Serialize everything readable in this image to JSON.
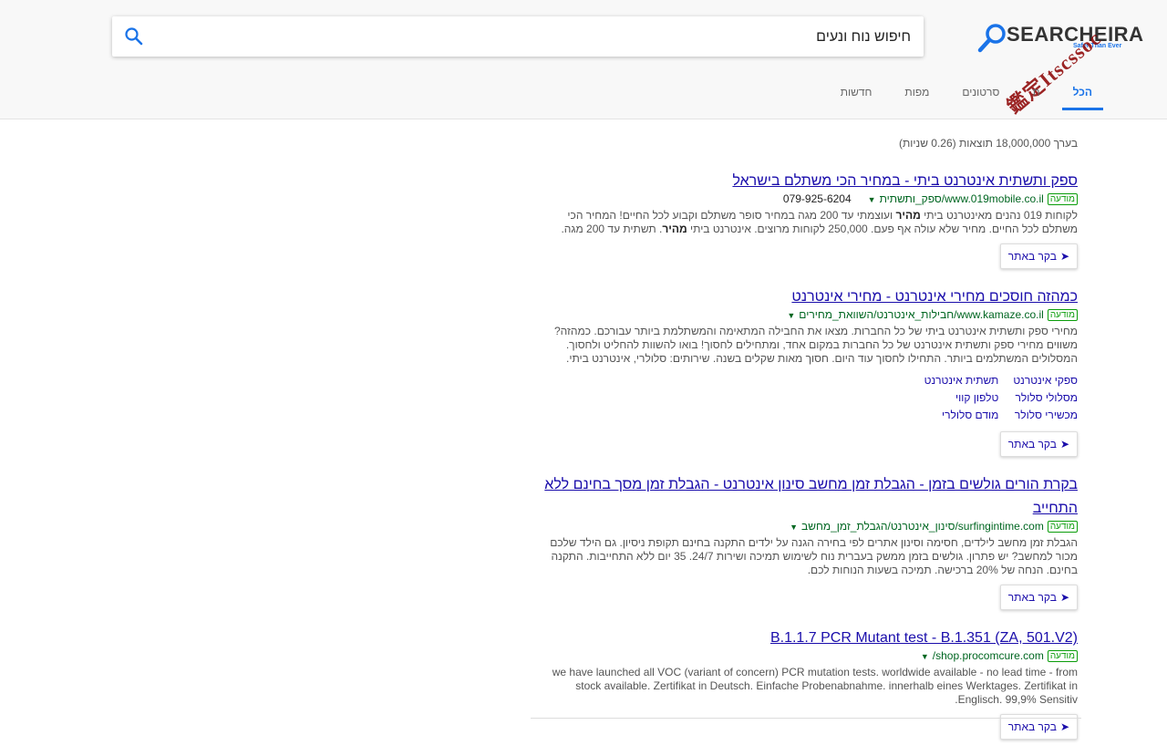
{
  "search": {
    "query": "חיפוש נוח ונעים"
  },
  "logo": {
    "name": "SEARCHEIRA",
    "tagline": "Safer Than Ever",
    "stamp": "鑑定Itscssoc"
  },
  "tabs": [
    {
      "label": "הכל",
      "active": true
    },
    {
      "label": "ת"
    },
    {
      "label": "סרטונים"
    },
    {
      "label": "מפות"
    },
    {
      "label": "חדשות"
    }
  ],
  "stats": "בערך 18,000,000 תוצאות (0.26 שניות)",
  "ad_label": "מודעה",
  "visit_label": "בקר באתר",
  "results": [
    {
      "title": "ספק ותשתית אינטרנט ביתי - במחיר הכי משתלם בישראל",
      "url": "www.019mobile.co.il/ספק_ותשתית",
      "phone": "079-925-6204",
      "desc_a": "לקוחות 019 נהנים מאינטרנט ביתי ",
      "desc_b": "מהיר",
      "desc_c": " ועוצמתי עד 200 מגה במחיר סופר משתלם וקבוע לכל החיים! המחיר הכי משתלם לכל החיים. מחיר שלא עולה אף פעם. 250,000 לקוחות מרוצים. אינטרנט ביתי ",
      "desc_d": "מהיר",
      "desc_e": ". תשתית עד 200 מגה."
    },
    {
      "title": "כמהזה חוסכים מחירי אינטרנט - מחירי אינטרנט",
      "url": "www.kamaze.co.il/חבילות_אינטרנט/השוואת_מחירים",
      "desc": "מחירי ספק ותשתית אינטרנט ביתי של כל החברות. מצאו את החבילה המתאימה והמשתלמת ביותר עבורכם. כמהזה? משווים מחירי ספק ותשתית אינטרנט של כל החברות במקום אחד, ומתחילים לחסוך! בואו להשוות להחליט ולחסוך. המסלולים המשתלמים ביותר. התחילו לחסוך עוד היום. חסוך מאות שקלים בשנה. שירותים: סלולרי, אינטרנט ביתי.",
      "sitelinks": [
        "ספקי אינטרנט",
        "תשתית אינטרנט",
        "מסלולי סלולר",
        "טלפון קווי",
        "מכשירי סלולר",
        "מודם סלולרי"
      ]
    },
    {
      "title": "בקרת הורים גולשים בזמן - הגבלת זמן מחשב סינון אינטרנט - הגבלת זמן מסך בחינם ללא התחייב",
      "url": "surfingintime.com/סינון_אינטרנט/הגבלת_זמן_מחשב",
      "desc": "הגבלת זמן מחשב לילדים, חסימה וסינון אתרים לפי בחירה הגנה על ילדים התקנה בחינם תקופת ניסיון. גם הילד שלכם מכור למחשב? יש פתרון. גולשים בזמן ממשק בעברית נוח לשימוש תמיכה ושירות 24/7. 35 יום ללא התחייבות. התקנה בחינם. הנחה של 20% ברכישה. תמיכה בשעות הנוחות לכם."
    },
    {
      "title": "B.1.1.7 PCR Mutant test - B.1.351 (ZA, 501.V2)",
      "url": "shop.procomcure.com/",
      "desc": "we have launched all VOC (variant of concern) PCR mutation tests. worldwide available - no lead time - from stock available. Zertifikat in Deutsch. Einfache Probenabnahme. innerhalb eines Werktages. Zertifikat in Englisch. 99,9% Sensitiv."
    }
  ]
}
